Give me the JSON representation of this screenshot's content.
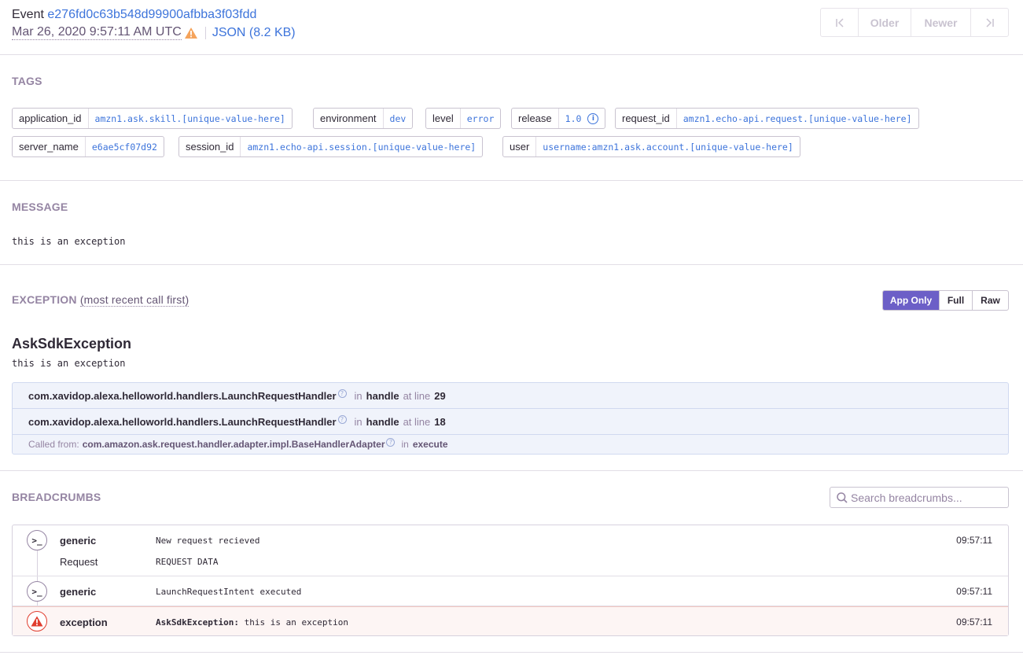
{
  "header": {
    "event_label": "Event",
    "event_id": "e276fd0c63b548d99900afbba3f03fdd",
    "date": "Mar 26, 2020 9:57:11 AM UTC",
    "json_link": "JSON (8.2 KB)",
    "pager": {
      "first": "⇤",
      "older": "Older",
      "newer": "Newer",
      "last": "⇥"
    }
  },
  "tags": {
    "title": "TAGS",
    "items": [
      {
        "key": "application_id",
        "value": "amzn1.ask.skill.[unique-value-here]"
      },
      {
        "key": "environment",
        "value": "dev"
      },
      {
        "key": "level",
        "value": "error"
      },
      {
        "key": "release",
        "value": "1.0"
      },
      {
        "key": "request_id",
        "value": "amzn1.echo-api.request.[unique-value-here]"
      },
      {
        "key": "server_name",
        "value": "e6ae5cf07d92"
      },
      {
        "key": "session_id",
        "value": "amzn1.echo-api.session.[unique-value-here]"
      },
      {
        "key": "user",
        "value": "username:amzn1.ask.account.[unique-value-here]"
      }
    ]
  },
  "message": {
    "title": "MESSAGE",
    "text": "this is an exception"
  },
  "exception": {
    "title": "EXCEPTION",
    "subtitle": "(most recent call first)",
    "buttons": {
      "app_only": "App Only",
      "full": "Full",
      "raw": "Raw"
    },
    "type": "AskSdkException",
    "value": "this is an exception",
    "frames": [
      {
        "module": "com.xavidop.alexa.helloworld.handlers.LaunchRequestHandler",
        "in": "in",
        "function": "handle",
        "at_line": "at line",
        "line": "29"
      },
      {
        "module": "com.xavidop.alexa.helloworld.handlers.LaunchRequestHandler",
        "in": "in",
        "function": "handle",
        "at_line": "at line",
        "line": "18"
      }
    ],
    "called_from": {
      "label": "Called from:",
      "module": "com.amazon.ask.request.handler.adapter.impl.BaseHandlerAdapter",
      "in": "in",
      "function": "execute"
    }
  },
  "breadcrumbs": {
    "title": "BREADCRUMBS",
    "search_placeholder": "Search breadcrumbs...",
    "items": [
      {
        "icon": "terminal-icon",
        "category": "generic",
        "message": "New request recieved",
        "time": "09:57:11",
        "data_label": "Request",
        "data_value": "REQUEST DATA"
      },
      {
        "icon": "terminal-icon",
        "category": "generic",
        "message": "LaunchRequestIntent executed",
        "time": "09:57:11"
      },
      {
        "icon": "warning-icon",
        "category": "exception",
        "message_bold": "AskSdkException:",
        "message": "this is an exception",
        "time": "09:57:11"
      }
    ]
  },
  "colors": {
    "accent": "#6c5fc7",
    "link": "#3d74db",
    "muted": "#9585a3",
    "error": "#e03e2f",
    "warning": "#f5a35b"
  }
}
